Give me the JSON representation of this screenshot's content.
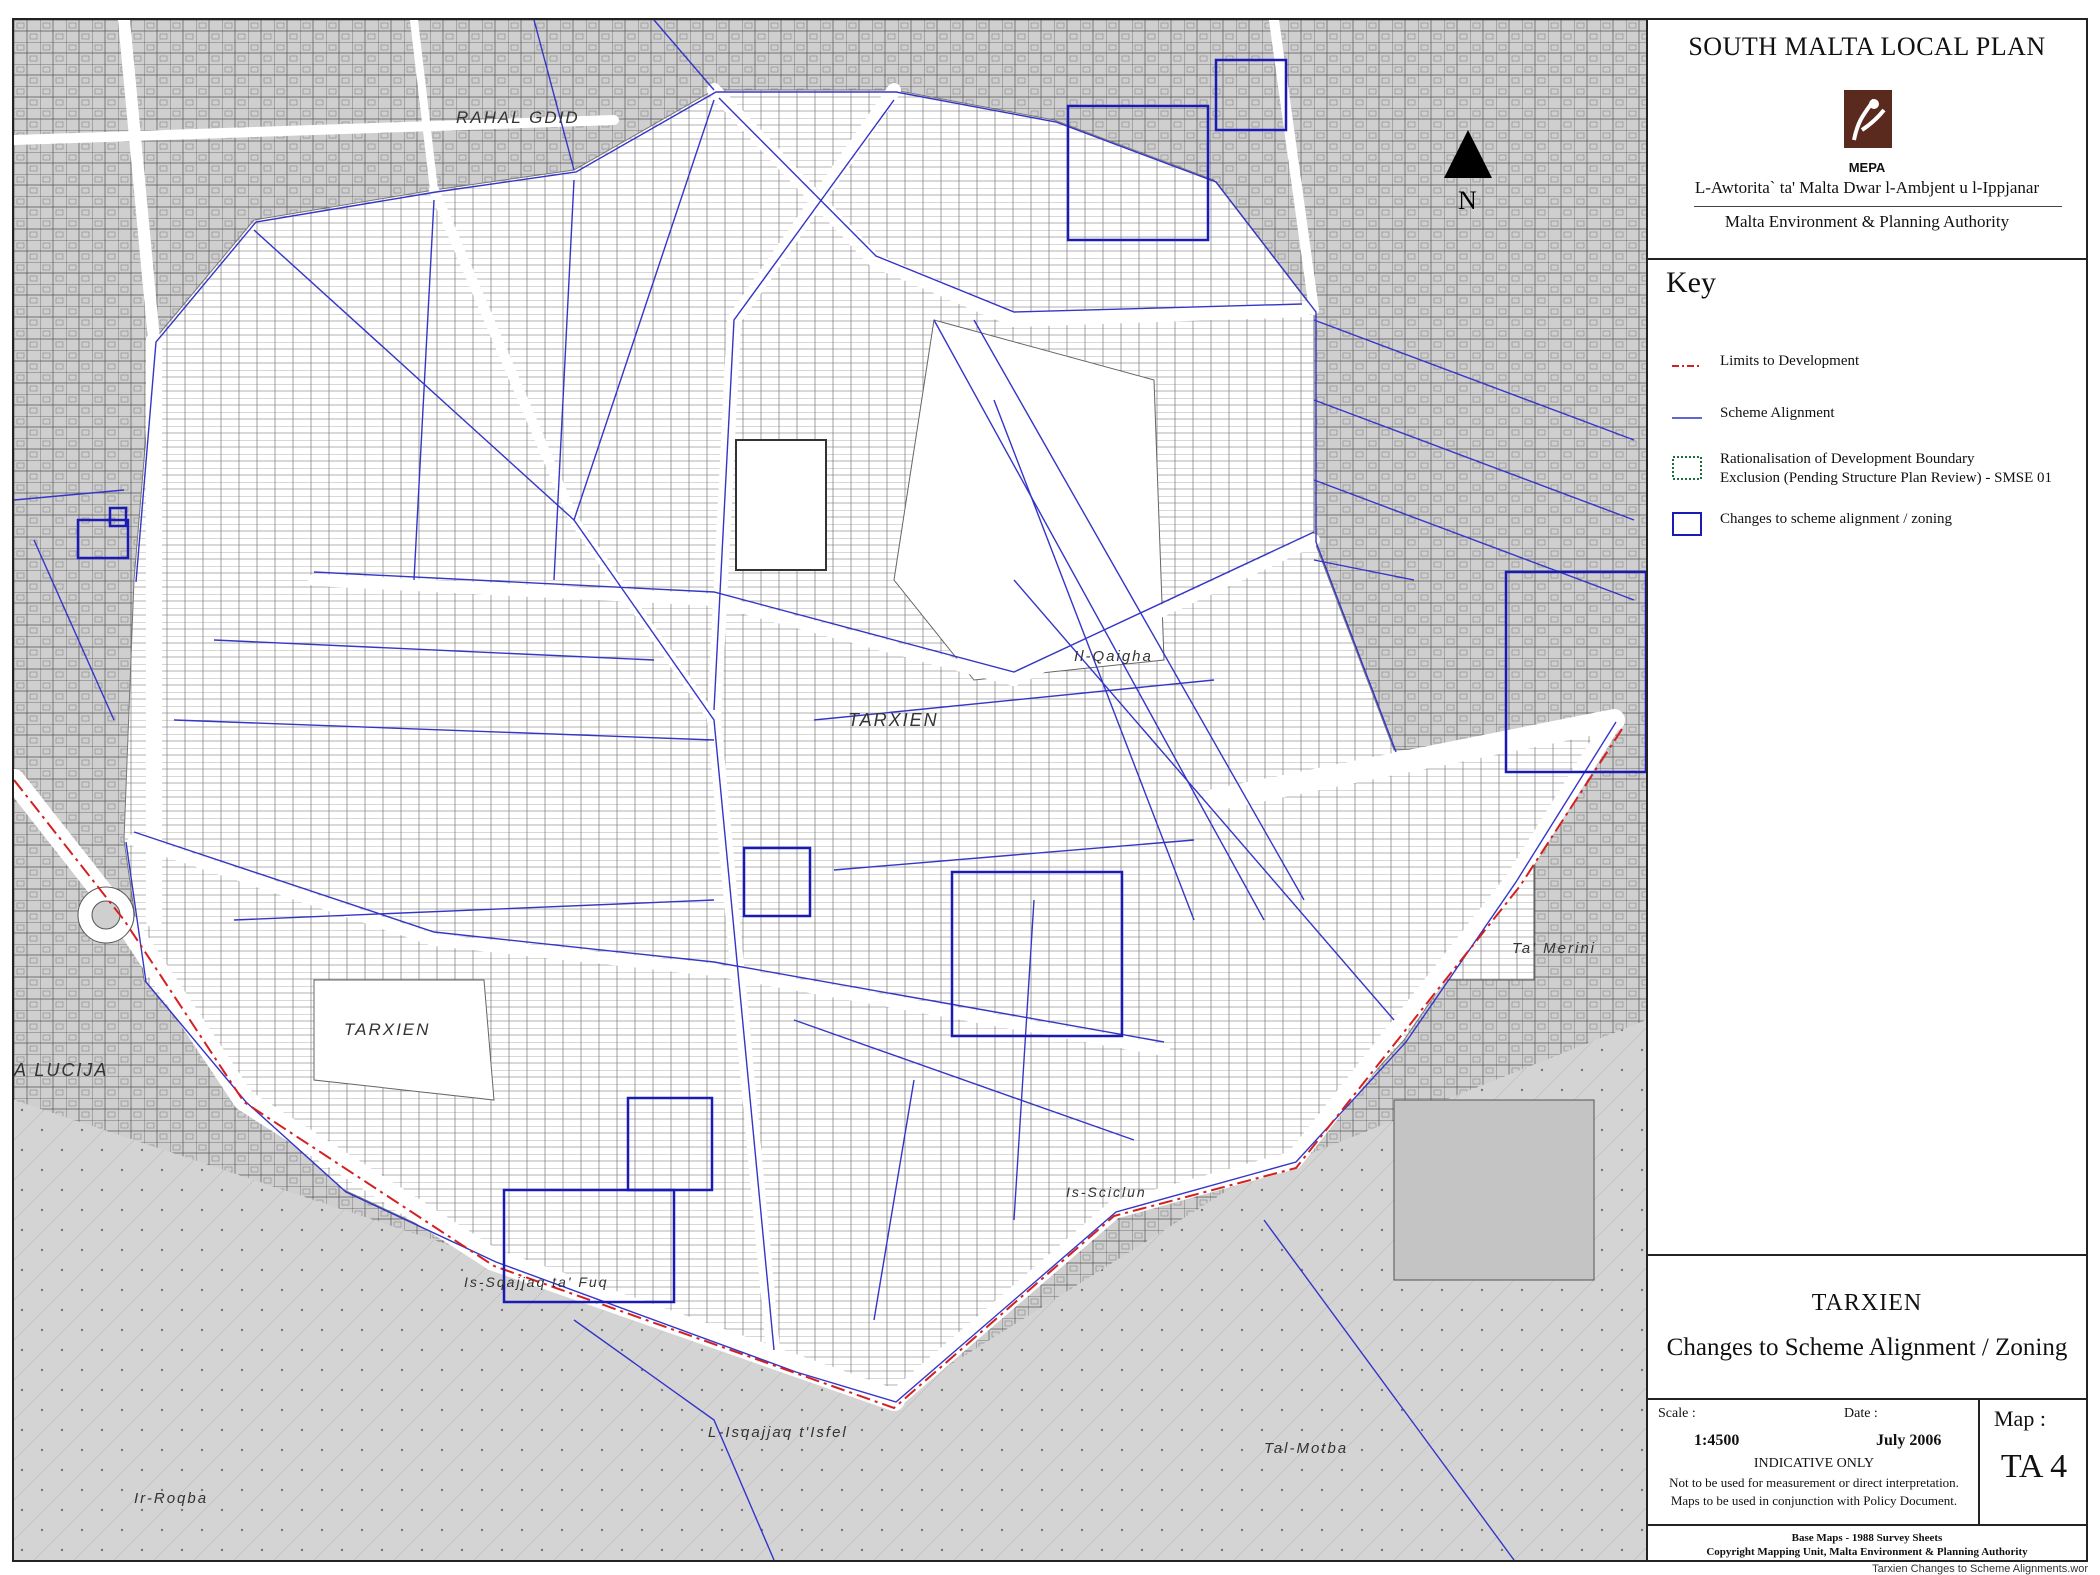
{
  "plan_title": "SOUTH MALTA LOCAL PLAN",
  "logo_text": "MEPA",
  "authority_mt": "L-Awtorita` ta' Malta Dwar l-Ambjent u l-Ippjanar",
  "authority_en": "Malta Environment & Planning Authority",
  "key": {
    "title": "Key",
    "items": [
      {
        "label": "Limits to Development",
        "symbol": "red-dash-dot-line",
        "color": "#d42020"
      },
      {
        "label": "Scheme Alignment",
        "symbol": "blue-line",
        "color": "#3030c8"
      },
      {
        "label_line1": "Rationalisation of Development Boundary",
        "label_line2": "Exclusion (Pending Structure Plan Review) - SMSE 01",
        "symbol": "green-dotted-box",
        "color": "#1e6e3c"
      },
      {
        "label": "Changes to scheme alignment / zoning",
        "symbol": "blue-box",
        "color": "#1a1ab4"
      }
    ]
  },
  "map_name": "TARXIEN",
  "map_subtitle": "Changes to Scheme Alignment / Zoning",
  "scale_label": "Scale :",
  "scale_value": "1:4500",
  "date_label": "Date :",
  "date_value": "July 2006",
  "indicative": "INDICATIVE ONLY",
  "disclaimer_1": "Not to be used for measurement or direct interpretation.",
  "disclaimer_2": "Maps to be used in conjunction with Policy Document.",
  "map_number_label": "Map :",
  "map_number": "TA 4",
  "base_maps": "Base Maps - 1988 Survey Sheets",
  "copyright": "Copyright Mapping Unit, Malta Environment & Planning Authority",
  "filename": "Tarxien Changes to Scheme Alignments.wor",
  "north_label": "N",
  "map": {
    "places": [
      "RAHAL GDID",
      "TARXIEN",
      "TARXIEN",
      "Il-Qaigha",
      "Ta' Merini",
      "Tal-Motba",
      "L-Isqajjaq t'Isfel",
      "Ir-Roqba",
      "Is-Sciclun",
      "Is-Sqajjaq ta' Fuq",
      "A LUCIJA"
    ],
    "colors": {
      "base": "#cfcfcf",
      "street": "#ffffff",
      "alignment": "#3535c8",
      "change_box": "#1a1ab4",
      "limit": "#d42020"
    },
    "change_boxes": 9
  }
}
